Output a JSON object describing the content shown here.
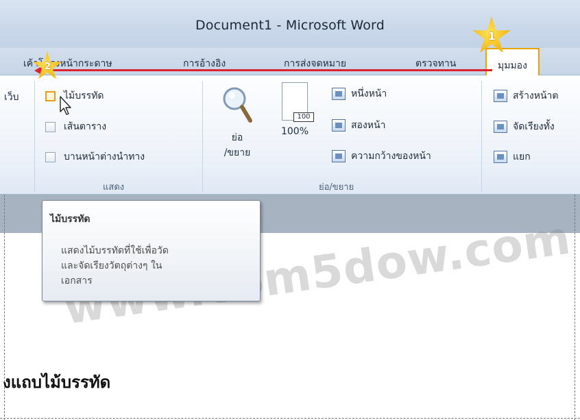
{
  "window": {
    "title": "Document1  -  Microsoft Word"
  },
  "tabs": [
    {
      "label": "เค้าโครงหน้ากระดาษ"
    },
    {
      "label": "การอ้างอิง"
    },
    {
      "label": "การส่งจดหมาย"
    },
    {
      "label": "ตรวจทาน"
    },
    {
      "label": "มุมมอง",
      "active": true
    }
  ],
  "ribbon": {
    "left_partial": "เว็บ",
    "show_group": {
      "label": "แสดง",
      "checkboxes": [
        {
          "label": "ไม้บรรทัด",
          "checked": false,
          "hovered": true
        },
        {
          "label": "เส้นตาราง",
          "checked": false
        },
        {
          "label": "บานหน้าต่างนำทาง",
          "checked": false
        }
      ]
    },
    "zoom_group": {
      "label": "ย่อ/ขยาย",
      "zoom_button": {
        "line1": "ย่อ",
        "line2": "/ขยาย"
      },
      "zoom100": {
        "label": "100%",
        "icon_text": "100"
      },
      "views": [
        {
          "label": "หนึ่งหน้า"
        },
        {
          "label": "สองหน้า"
        },
        {
          "label": "ความกว้างของหน้า"
        }
      ]
    },
    "window_group": {
      "items": [
        {
          "label": "สร้างหน้าต"
        },
        {
          "label": "จัดเรียงทั้ง"
        },
        {
          "label": "แยก"
        }
      ]
    }
  },
  "tooltip": {
    "title": "ไม้บรรทัด",
    "body_lines": [
      "แสดงไม้บรรทัดที่ใช้เพื่อวัด",
      "และจัดเรียงวัตถุต่างๆ ใน",
      "เอกสาร"
    ]
  },
  "watermark": "www.com5dow.com",
  "document": {
    "heading": "งแถบไม้บรรทัด"
  },
  "callouts": [
    {
      "number": "1"
    },
    {
      "number": "2"
    }
  ],
  "colors": {
    "active_tab_border": "#e8a400",
    "arrow": "#e0202a",
    "star": "#f0b20a"
  }
}
